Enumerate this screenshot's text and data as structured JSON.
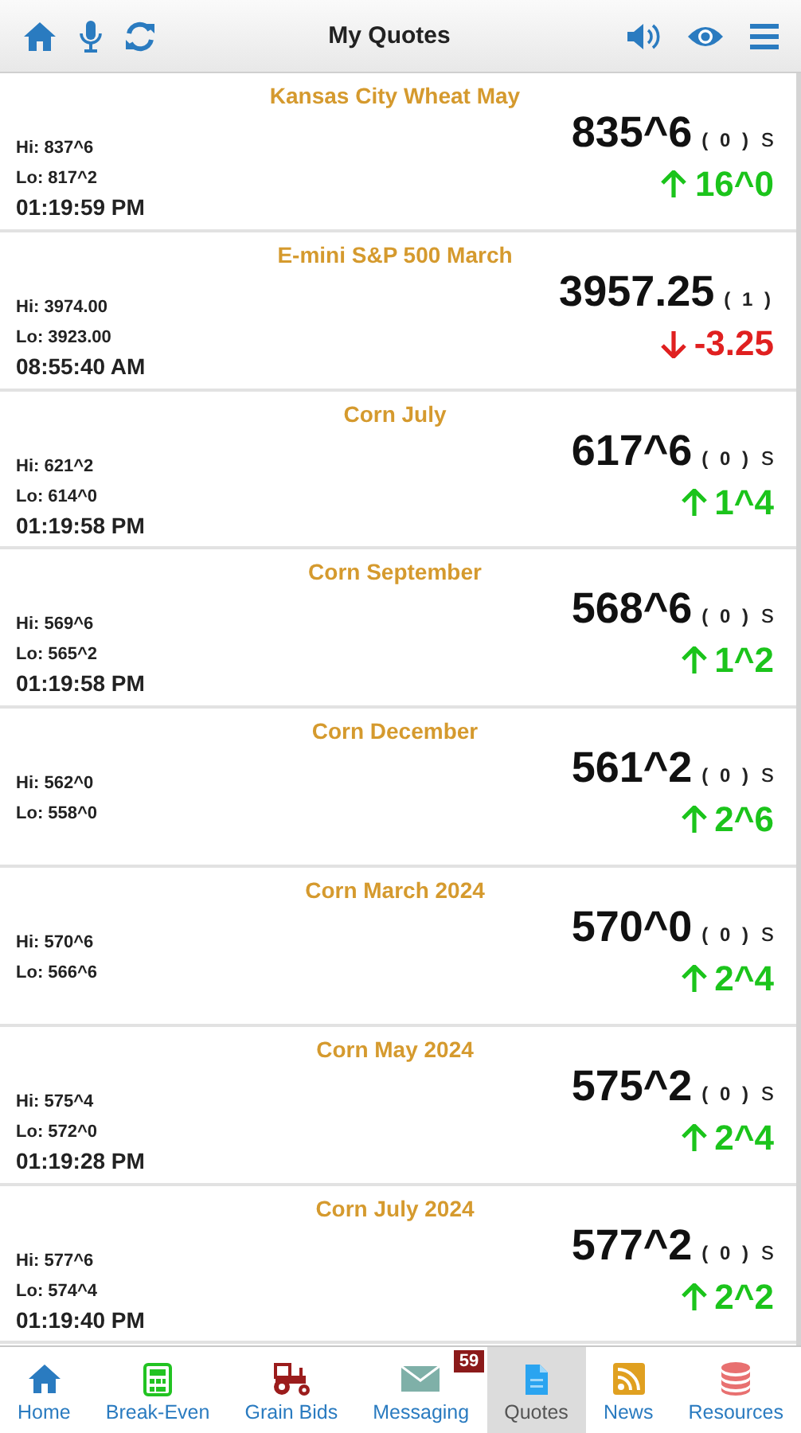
{
  "header": {
    "title": "My Quotes"
  },
  "quotes": [
    {
      "name": "Kansas City Wheat May",
      "hi": "Hi: 837^6",
      "lo": "Lo: 817^2",
      "time": "01:19:59 PM",
      "price": "835^6",
      "count": "( 0 )",
      "flag": "s",
      "rising": true,
      "change": "16^0"
    },
    {
      "name": "E-mini S&P 500 March",
      "hi": "Hi: 3974.00",
      "lo": "Lo: 3923.00",
      "time": "08:55:40 AM",
      "price": "3957.25",
      "count": "( 1 )",
      "rising": false,
      "change": "-3.25"
    },
    {
      "name": "Corn July",
      "hi": "Hi: 621^2",
      "lo": "Lo: 614^0",
      "time": "01:19:58 PM",
      "price": "617^6",
      "count": "( 0 )",
      "flag": "s",
      "rising": true,
      "change": "1^4"
    },
    {
      "name": "Corn September",
      "hi": "Hi: 569^6",
      "lo": "Lo: 565^2",
      "time": "01:19:58 PM",
      "price": "568^6",
      "count": "( 0 )",
      "flag": "s",
      "rising": true,
      "change": "1^2"
    },
    {
      "name": "Corn December",
      "hi": "Hi: 562^0",
      "lo": "Lo: 558^0",
      "price": "561^2",
      "count": "( 0 )",
      "flag": "s",
      "rising": true,
      "change": "2^6"
    },
    {
      "name": "Corn March 2024",
      "hi": "Hi: 570^6",
      "lo": "Lo: 566^6",
      "price": "570^0",
      "count": "( 0 )",
      "flag": "s",
      "rising": true,
      "change": "2^4"
    },
    {
      "name": "Corn May 2024",
      "hi": "Hi: 575^4",
      "lo": "Lo: 572^0",
      "time": "01:19:28 PM",
      "price": "575^2",
      "count": "( 0 )",
      "flag": "s",
      "rising": true,
      "change": "2^4"
    },
    {
      "name": "Corn July 2024",
      "hi": "Hi: 577^6",
      "lo": "Lo: 574^4",
      "time": "01:19:40 PM",
      "price": "577^2",
      "count": "( 0 )",
      "flag": "s",
      "rising": true,
      "change": "2^2"
    }
  ],
  "nav": [
    {
      "kind": "home",
      "label": "Home",
      "selected": false
    },
    {
      "kind": "calculator",
      "label": "Break-Even",
      "selected": false
    },
    {
      "kind": "tractor",
      "label": "Grain Bids",
      "selected": false
    },
    {
      "kind": "envelope",
      "label": "Messaging",
      "selected": false,
      "badge": "59"
    },
    {
      "kind": "document",
      "label": "Quotes",
      "selected": true
    },
    {
      "kind": "rss",
      "label": "News",
      "selected": false
    },
    {
      "kind": "database",
      "label": "Resources",
      "selected": false
    }
  ]
}
